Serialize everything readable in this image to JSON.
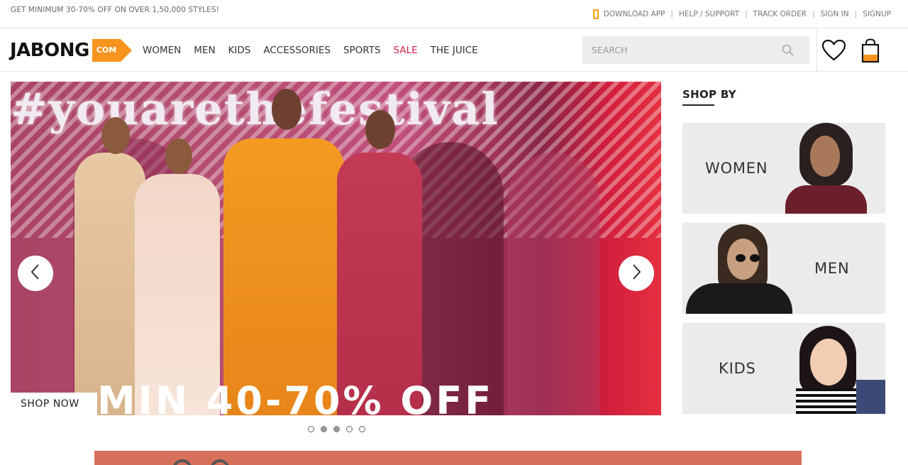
{
  "promo": {
    "text": "GET MINIMUM 30-70% OFF ON OVER 1,50,000 STYLES!"
  },
  "top_links": {
    "download_app": "DOWNLOAD APP",
    "help": "HELP / SUPPORT",
    "track": "TRACK ORDER",
    "sign_in": "SIGN IN",
    "signup": "SIGNUP",
    "separator": "|"
  },
  "logo": {
    "name": "JABONG",
    "tag": "COM"
  },
  "nav": {
    "women": "WOMEN",
    "men": "MEN",
    "kids": "KIDS",
    "accessories": "ACCESSORIES",
    "sports": "SPORTS",
    "sale": "SALE",
    "juice": "THE JUICE"
  },
  "search": {
    "placeholder": "SEARCH"
  },
  "banner": {
    "headline": "#youarethefestival",
    "offer": "MIN 40-70% OFF",
    "cta": "SHOP NOW"
  },
  "carousel": {
    "dots": 5,
    "active_dots": [
      2,
      3
    ]
  },
  "shop_by": {
    "title": "SHOP BY",
    "women": "WOMEN",
    "men": "MEN",
    "kids": "KIDS"
  },
  "colors": {
    "brand_orange": "#f7941d",
    "sale_red": "#d6264d",
    "banner_magenta": "#b44d72"
  },
  "icons": [
    "phone-icon",
    "search-icon",
    "heart-icon",
    "bag-icon",
    "chevron-left-icon",
    "chevron-right-icon"
  ]
}
